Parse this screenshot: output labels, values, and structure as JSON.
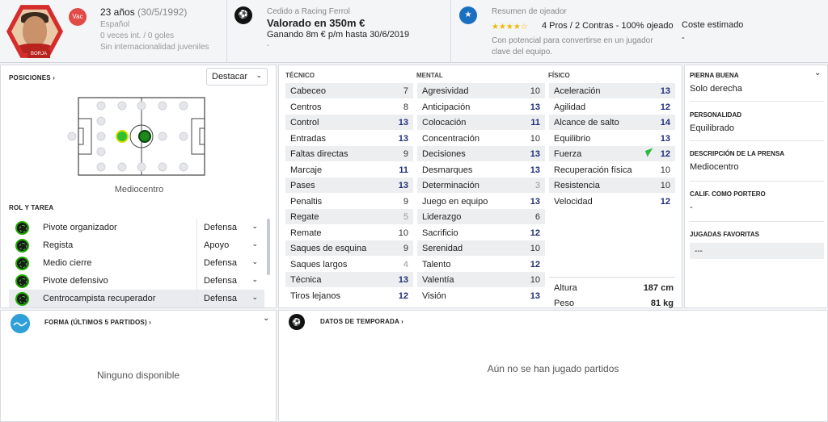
{
  "header": {
    "avatar_name": "BORJA",
    "status_badge": "Vac",
    "age": "23 años",
    "dob": "(30/5/1992)",
    "nationality": "Español",
    "caps": "0 veces int. / 0 goles",
    "youth": "Sin internacionalidad juveniles",
    "loan_label": "Cedido a Racing Ferrol",
    "value": "Valorado en 350m €",
    "wage": "Ganando 8m € p/m hasta 30/6/2019",
    "loan_dash": "-",
    "scout_label": "Resumen de ojeador",
    "stars": "★★★★☆",
    "scout_summary": "4 Pros / 2 Contras - 100% ojeado",
    "scout_desc": "Con potencial para convertirse en un jugador clave del equipo.",
    "cost_label": "Coste estimado",
    "cost_value": "-"
  },
  "positions": {
    "title": "POSICIONES ›",
    "dropdown": "Destacar",
    "pitch_label": "Mediocentro"
  },
  "roles": {
    "title": "ROL Y TAREA",
    "items": [
      {
        "name": "Pivote organizador",
        "duty": "Defensa"
      },
      {
        "name": "Regista",
        "duty": "Apoyo"
      },
      {
        "name": "Medio cierre",
        "duty": "Defensa"
      },
      {
        "name": "Pivote defensivo",
        "duty": "Defensa"
      },
      {
        "name": "Centrocampista recuperador",
        "duty": "Defensa"
      }
    ]
  },
  "attributes": {
    "tecnico_title": "TÉCNICO",
    "mental_title": "MENTAL",
    "fisico_title": "FÍSICO",
    "tecnico": [
      {
        "name": "Cabeceo",
        "value": "7"
      },
      {
        "name": "Centros",
        "value": "8"
      },
      {
        "name": "Control",
        "value": "13"
      },
      {
        "name": "Entradas",
        "value": "13"
      },
      {
        "name": "Faltas directas",
        "value": "9"
      },
      {
        "name": "Marcaje",
        "value": "11"
      },
      {
        "name": "Pases",
        "value": "13"
      },
      {
        "name": "Penaltis",
        "value": "9"
      },
      {
        "name": "Regate",
        "value": "5"
      },
      {
        "name": "Remate",
        "value": "10"
      },
      {
        "name": "Saques de esquina",
        "value": "9"
      },
      {
        "name": "Saques largos",
        "value": "4"
      },
      {
        "name": "Técnica",
        "value": "13"
      },
      {
        "name": "Tiros lejanos",
        "value": "12"
      }
    ],
    "mental": [
      {
        "name": "Agresividad",
        "value": "10"
      },
      {
        "name": "Anticipación",
        "value": "13"
      },
      {
        "name": "Colocación",
        "value": "11"
      },
      {
        "name": "Concentración",
        "value": "10"
      },
      {
        "name": "Decisiones",
        "value": "13"
      },
      {
        "name": "Desmarques",
        "value": "13"
      },
      {
        "name": "Determinación",
        "value": "3"
      },
      {
        "name": "Juego en equipo",
        "value": "13"
      },
      {
        "name": "Liderazgo",
        "value": "6"
      },
      {
        "name": "Sacrificio",
        "value": "12"
      },
      {
        "name": "Serenidad",
        "value": "10"
      },
      {
        "name": "Talento",
        "value": "12"
      },
      {
        "name": "Valentía",
        "value": "10"
      },
      {
        "name": "Visión",
        "value": "13"
      }
    ],
    "fisico": [
      {
        "name": "Aceleración",
        "value": "13"
      },
      {
        "name": "Agilidad",
        "value": "12"
      },
      {
        "name": "Alcance de salto",
        "value": "14"
      },
      {
        "name": "Equilibrio",
        "value": "13"
      },
      {
        "name": "Fuerza",
        "value": "12"
      },
      {
        "name": "Recuperación física",
        "value": "10"
      },
      {
        "name": "Resistencia",
        "value": "10"
      },
      {
        "name": "Velocidad",
        "value": "12"
      }
    ],
    "height_label": "Altura",
    "height_value": "187 cm",
    "weight_label": "Peso",
    "weight_value": "81 kg"
  },
  "info": {
    "pierna_title": "PIERNA BUENA",
    "pierna_value": "Solo derecha",
    "personalidad_title": "PERSONALIDAD",
    "personalidad_value": "Equilibrado",
    "prensa_title": "DESCRIPCIÓN DE LA PRENSA",
    "prensa_value": "Mediocentro",
    "portero_title": "CALIF. COMO PORTERO",
    "portero_value": "-",
    "jugadas_title": "JUGADAS FAVORITAS",
    "jugadas_value": "---"
  },
  "forma": {
    "title": "FORMA (ÚLTIMOS 5 PARTIDOS) ›",
    "empty": "Ninguno disponible"
  },
  "temporada": {
    "title": "DATOS DE TEMPORADA ›",
    "empty": "Aún no se han jugado partidos"
  }
}
